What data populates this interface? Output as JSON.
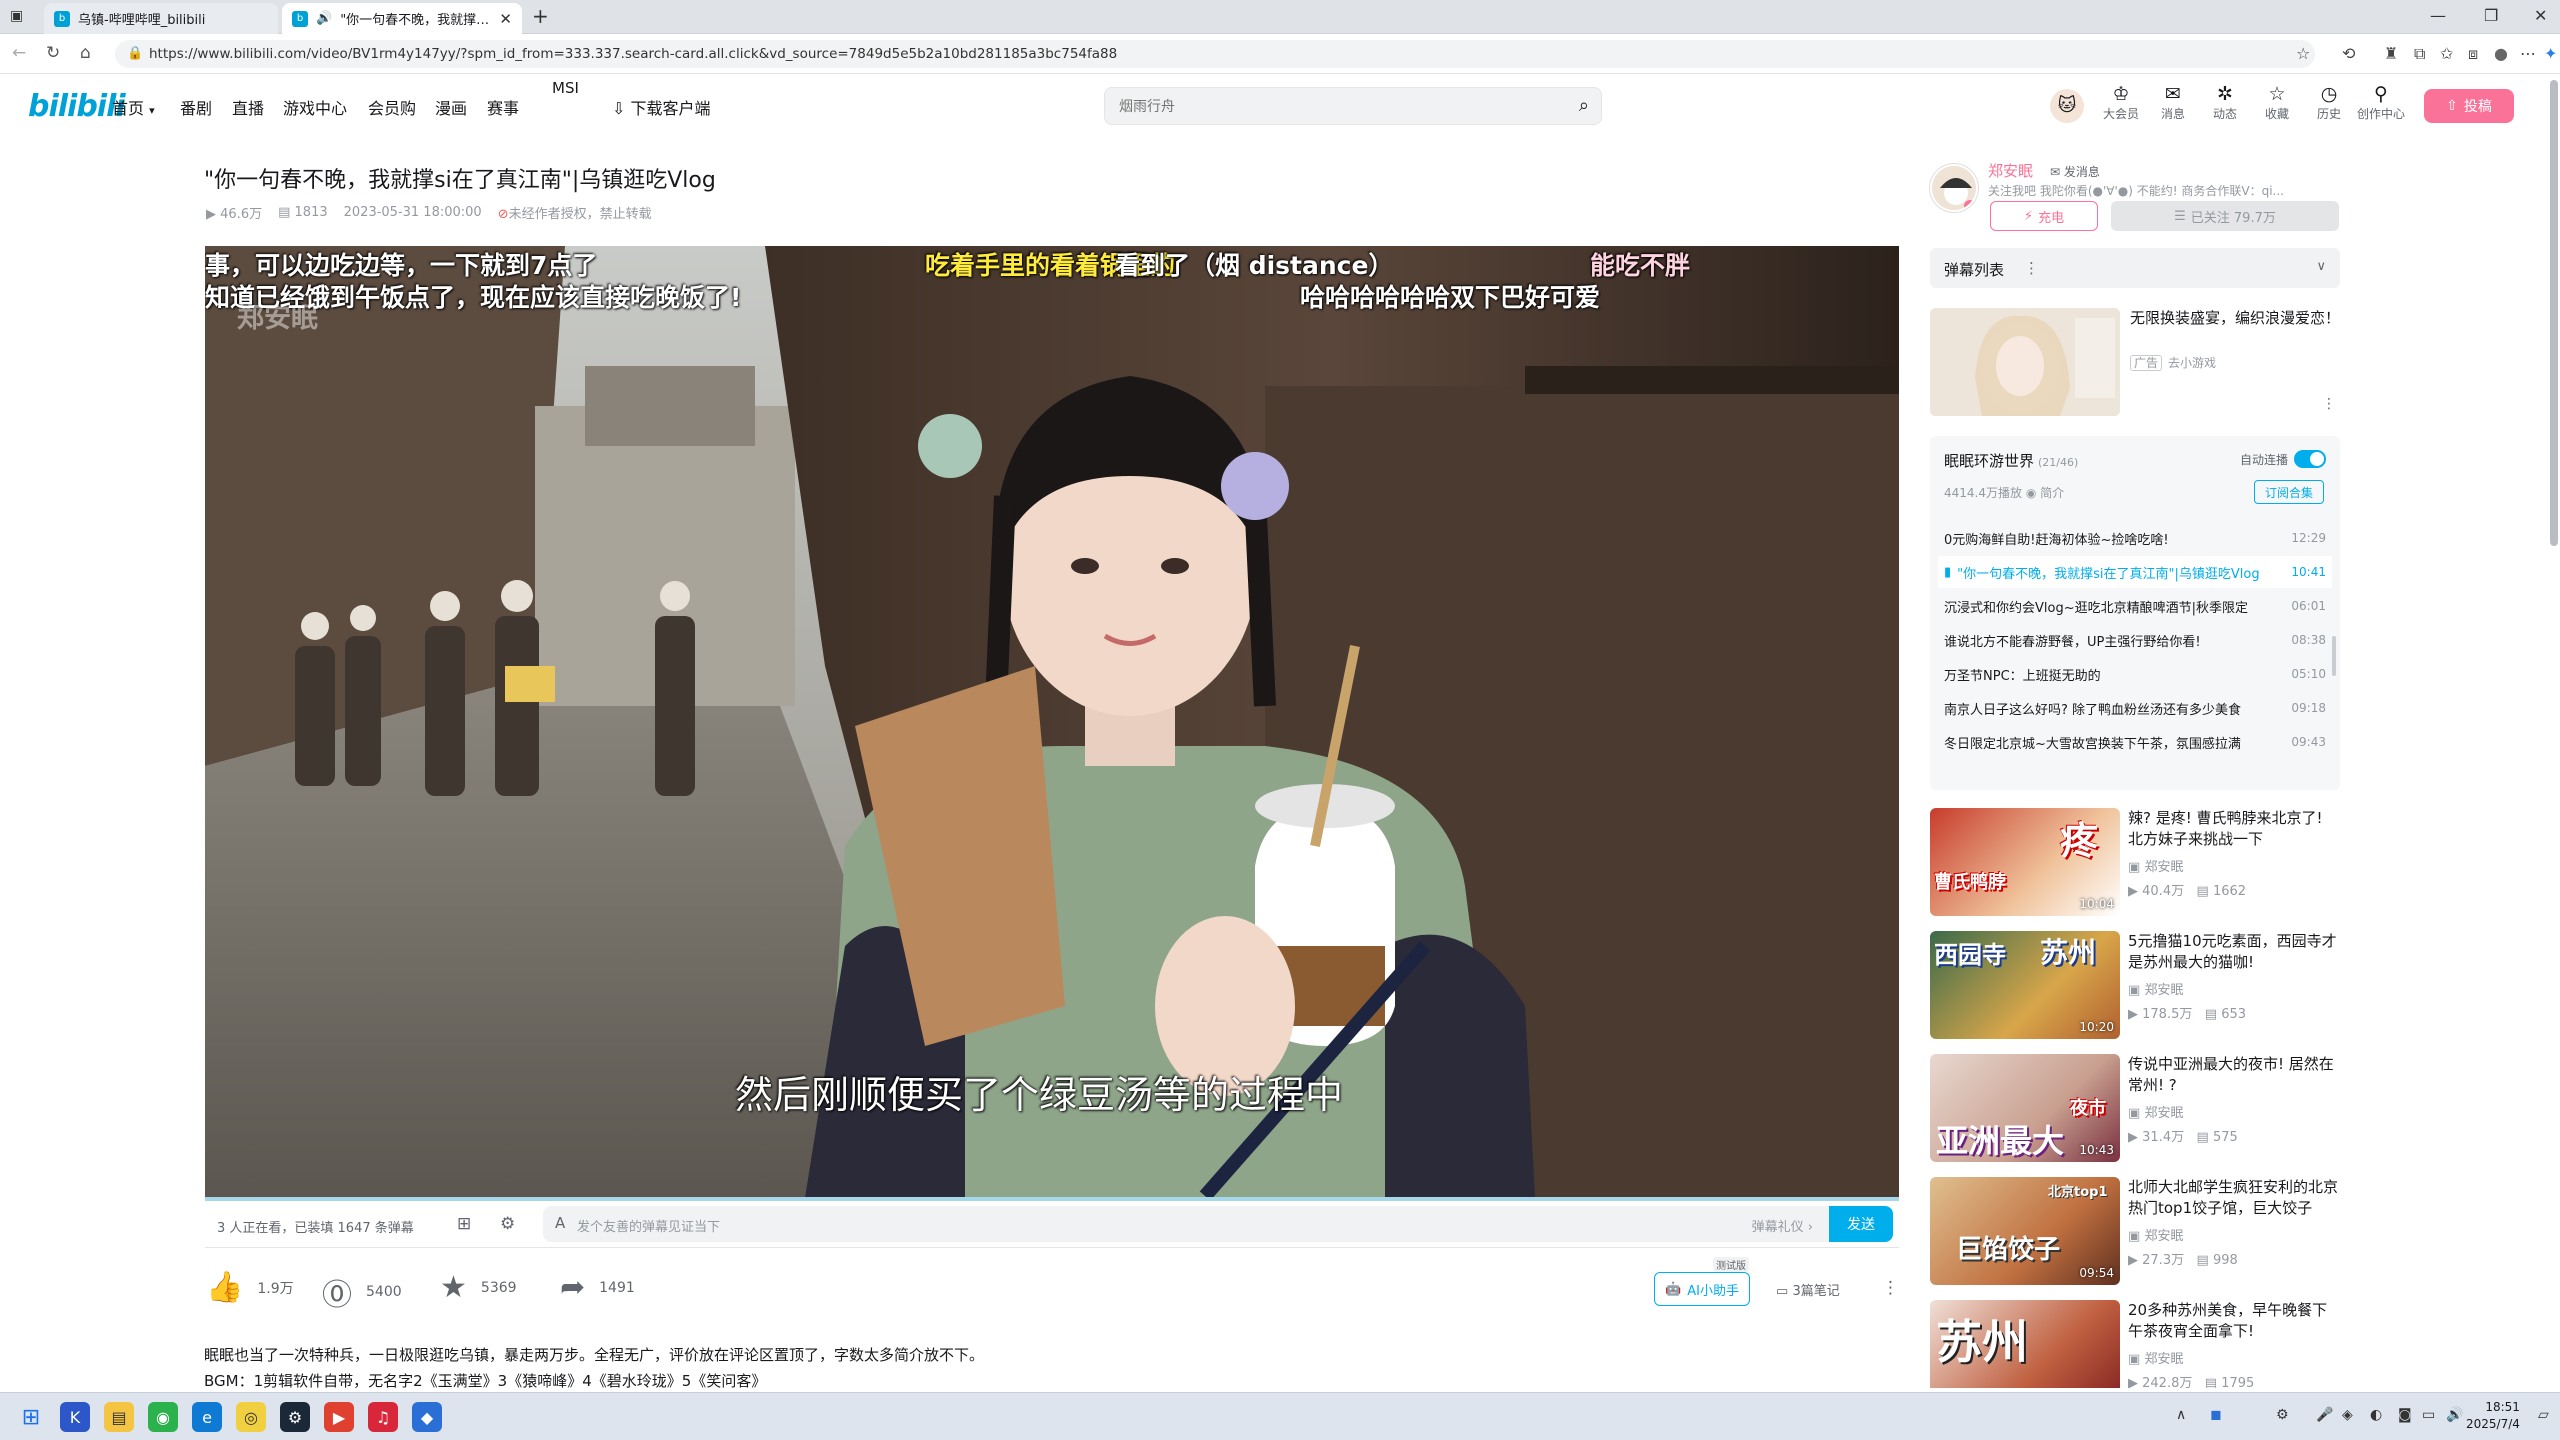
{
  "browser": {
    "tabs": [
      {
        "title": "乌镇-哔哩哔哩_bilibili",
        "active": false
      },
      {
        "title": "\"你一句春不晚，我就撑si在了真江南\"|乌镇逛吃Vlog_哔哩哔哩_bilibili",
        "active": true
      }
    ],
    "url": "https://www.bilibili.com/video/BV1rm4y147yy/?spm_id_from=333.337.search-card.all.click&vd_source=7849d5e5b2a10bd281185a3bc754fa88",
    "new_tab": "+"
  },
  "header": {
    "logo": "bilibili",
    "nav": [
      "首页",
      "番剧",
      "直播",
      "游戏中心",
      "会员购",
      "漫画",
      "赛事",
      "MSI",
      "下载客户端"
    ],
    "search_placeholder": "烟雨行舟",
    "icons": [
      {
        "icon": "crown-icon",
        "label": "大会员"
      },
      {
        "icon": "message-icon",
        "label": "消息"
      },
      {
        "icon": "dynamic-icon",
        "label": "动态"
      },
      {
        "icon": "star-icon",
        "label": "收藏"
      },
      {
        "icon": "clock-icon",
        "label": "历史"
      },
      {
        "icon": "bulb-icon",
        "label": "创作中心"
      }
    ],
    "upload": "投稿"
  },
  "video": {
    "title": "\"你一句春不晚，我就撑si在了真江南\"|乌镇逛吃Vlog",
    "views": "46.6万",
    "danmaku": "1813",
    "date": "2023-05-31 18:00:00",
    "copyright": "未经作者授权，禁止转载",
    "subtitles": {
      "top_left_1": "事，可以边吃边等，一下就到7点了",
      "top_left_2": "知道已经饿到午饭点了，现在应该直接吃晚饭了!",
      "top_center": "吃着手里的看着锅里的",
      "top_center_2": "看到了（烟 distance）",
      "top_right": "能吃不胖",
      "top_right_2": "哈哈哈哈哈哈双下巴好可爱",
      "watermark": "郑安眠",
      "bottom": "然后刚顺便买了个绿豆汤等的过程中"
    },
    "watching": "3 人正在看，已装填 1647 条弹幕",
    "danmaku_placeholder": "发个友善的弹幕见证当下",
    "danmaku_etiquette": "弹幕礼仪 ›",
    "send": "发送",
    "likes": "1.9万",
    "coins": "5400",
    "favorites": "5369",
    "shares": "1491",
    "ai_helper": "AI小助手",
    "beta": "测试版",
    "notes": "3篇笔记",
    "desc_1": "眠眠也当了一次特种兵，一日极限逛吃乌镇，暴走两万步。全程无广，评价放在评论区置顶了，字数太多简介放不下。",
    "desc_2": "BGM：1剪辑软件自带，无名字2《玉满堂》3《猿啼峰》4《碧水玲珑》5《笑问客》"
  },
  "up": {
    "name": "郑安眠",
    "message": "发消息",
    "signature": "关注我吧 我陀你看(●'∀'●) 不能约! 商务合作联V：qi...",
    "charge": "充电",
    "follow": "已关注 79.7万"
  },
  "danmaku_list": {
    "label": "弹幕列表"
  },
  "ad": {
    "title": "无限换装盛宴，编织浪漫爱恋！",
    "tag": "广告",
    "source": "去小游戏"
  },
  "collection": {
    "title": "眠眠环游世界",
    "count": "(21/46)",
    "autoplay": "自动连播",
    "plays": "4414.4万播放",
    "intro": "简介",
    "subscribe": "订阅合集",
    "episodes": [
      {
        "title": "0元购海鲜自助!赶海初体验~捡啥吃啥!",
        "dur": "12:29",
        "current": false
      },
      {
        "title": "\"你一句春不晚，我就撑si在了真江南\"|乌镇逛吃Vlog",
        "dur": "10:41",
        "current": true
      },
      {
        "title": "沉浸式和你约会Vlog~逛吃北京精酿啤酒节|秋季限定",
        "dur": "06:01",
        "current": false
      },
      {
        "title": "谁说北方不能春游野餐，UP主强行野给你看!",
        "dur": "08:38",
        "current": false
      },
      {
        "title": "万圣节NPC：上班挺无助的",
        "dur": "05:10",
        "current": false
      },
      {
        "title": "南京人日子这么好吗? 除了鸭血粉丝汤还有多少美食",
        "dur": "09:18",
        "current": false
      },
      {
        "title": "冬日限定北京城~大雪故宫换装下午茶，氛围感拉满",
        "dur": "09:43",
        "current": false
      }
    ]
  },
  "recommendations": [
    {
      "title": "辣? 是疼! 曹氏鸭脖来北京了! 北方妹子来挑战一下",
      "up": "郑安眠",
      "views": "40.4万",
      "danmaku": "1662",
      "dur": "10:04",
      "overlay": "疼",
      "overlay2": "曹氏鸭脖"
    },
    {
      "title": "5元撸猫10元吃素面，西园寺才是苏州最大的猫咖!",
      "up": "郑安眠",
      "views": "178.5万",
      "danmaku": "653",
      "dur": "10:20",
      "overlay": "苏州",
      "overlay2": "西园寺"
    },
    {
      "title": "传说中亚洲最大的夜市! 居然在常州! ?",
      "up": "郑安眠",
      "views": "31.4万",
      "danmaku": "575",
      "dur": "10:43",
      "overlay": "亚洲最大",
      "overlay2": "夜市"
    },
    {
      "title": "北师大北邮学生疯狂安利的北京热门top1饺子馆，巨大饺子",
      "up": "郑安眠",
      "views": "27.3万",
      "danmaku": "998",
      "dur": "09:54",
      "overlay": "巨馅饺子",
      "overlay2": "北京top1"
    },
    {
      "title": "20多种苏州美食，早午晚餐下午茶夜宵全面拿下!",
      "up": "郑安眠",
      "views": "242.8万",
      "danmaku": "1795",
      "dur": "",
      "overlay": "苏州",
      "overlay2": ""
    }
  ],
  "taskbar": {
    "time": "18:51",
    "date": "2025/7/4"
  }
}
